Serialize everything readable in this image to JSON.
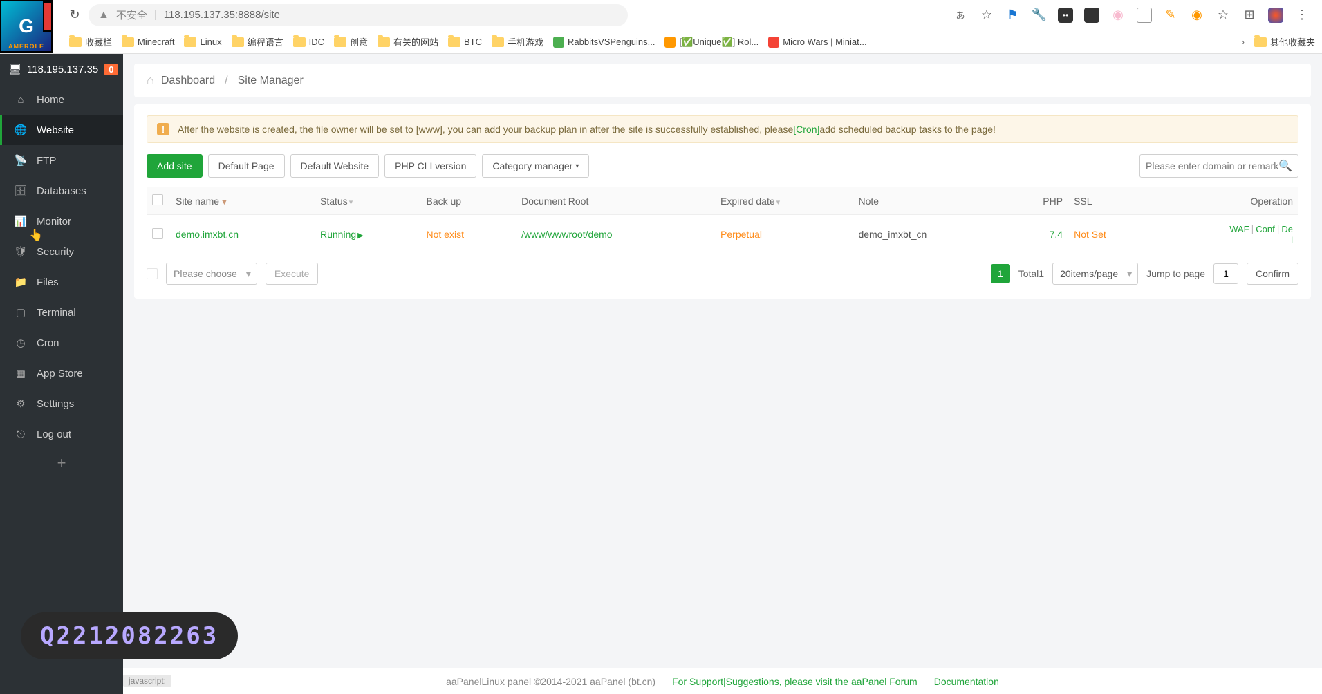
{
  "browser": {
    "insecure_label": "不安全",
    "url": "118.195.137.35:8888/site"
  },
  "bookmarks": {
    "items": [
      {
        "label": "收藏栏",
        "type": "folder"
      },
      {
        "label": "Minecraft",
        "type": "folder"
      },
      {
        "label": "Linux",
        "type": "folder"
      },
      {
        "label": "编程语言",
        "type": "folder"
      },
      {
        "label": "IDC",
        "type": "folder"
      },
      {
        "label": "创意",
        "type": "folder"
      },
      {
        "label": "有关的网站",
        "type": "folder"
      },
      {
        "label": "BTC",
        "type": "folder"
      },
      {
        "label": "手机游戏",
        "type": "folder"
      },
      {
        "label": "RabbitsVSPenguins...",
        "type": "link"
      },
      {
        "label": "[✅Unique✅] Rol...",
        "type": "link"
      },
      {
        "label": "Micro Wars | Miniat...",
        "type": "link"
      }
    ],
    "overflow_label": "其他收藏夹"
  },
  "sidebar": {
    "ip": "118.195.137.35",
    "badge": "0",
    "items": [
      {
        "label": "Home",
        "icon": "home"
      },
      {
        "label": "Website",
        "icon": "globe",
        "active": true
      },
      {
        "label": "FTP",
        "icon": "ftp"
      },
      {
        "label": "Databases",
        "icon": "db"
      },
      {
        "label": "Monitor",
        "icon": "monitor"
      },
      {
        "label": "Security",
        "icon": "shield"
      },
      {
        "label": "Files",
        "icon": "folder"
      },
      {
        "label": "Terminal",
        "icon": "terminal"
      },
      {
        "label": "Cron",
        "icon": "clock"
      },
      {
        "label": "App Store",
        "icon": "store"
      },
      {
        "label": "Settings",
        "icon": "gear"
      },
      {
        "label": "Log out",
        "icon": "logout"
      }
    ]
  },
  "breadcrumb": {
    "dashboard": "Dashboard",
    "current": "Site Manager"
  },
  "notice": {
    "text_before": "After the website is created, the file owner will be set to [www], you can add your backup plan in after the site is successfully established, please",
    "cron_link": "[Cron]",
    "text_after": "add scheduled backup tasks to the page!"
  },
  "toolbar": {
    "add_site": "Add site",
    "default_page": "Default Page",
    "default_website": "Default Website",
    "php_cli": "PHP CLI version",
    "category_mgr": "Category manager",
    "search_placeholder": "Please enter domain or remarks"
  },
  "table": {
    "headers": {
      "site_name": "Site name",
      "status": "Status",
      "backup": "Back up",
      "doc_root": "Document Root",
      "expired": "Expired date",
      "note": "Note",
      "php": "PHP",
      "ssl": "SSL",
      "operation": "Operation"
    },
    "rows": [
      {
        "site_name": "demo.imxbt.cn",
        "status": "Running",
        "backup": "Not exist",
        "doc_root": "/www/wwwroot/demo",
        "expired": "Perpetual",
        "note": "demo_imxbt_cn",
        "php": "7.4",
        "ssl": "Not Set",
        "op_waf": "WAF",
        "op_conf": "Conf",
        "op_del_1": "De",
        "op_del_2": "l"
      }
    ]
  },
  "footer_bar": {
    "choose_placeholder": "Please choose",
    "execute": "Execute",
    "page_current": "1",
    "total_label": "Total1",
    "per_page": "20items/page",
    "jump_label": "Jump to page",
    "jump_value": "1",
    "confirm": "Confirm"
  },
  "app_footer": {
    "copyright": "aaPanelLinux panel ©2014-2021 aaPanel (bt.cn)",
    "support": "For Support|Suggestions, please visit the aaPanel Forum",
    "docs": "Documentation"
  },
  "overlay": {
    "qq": "Q2212082263",
    "status_text": "javascript:"
  }
}
